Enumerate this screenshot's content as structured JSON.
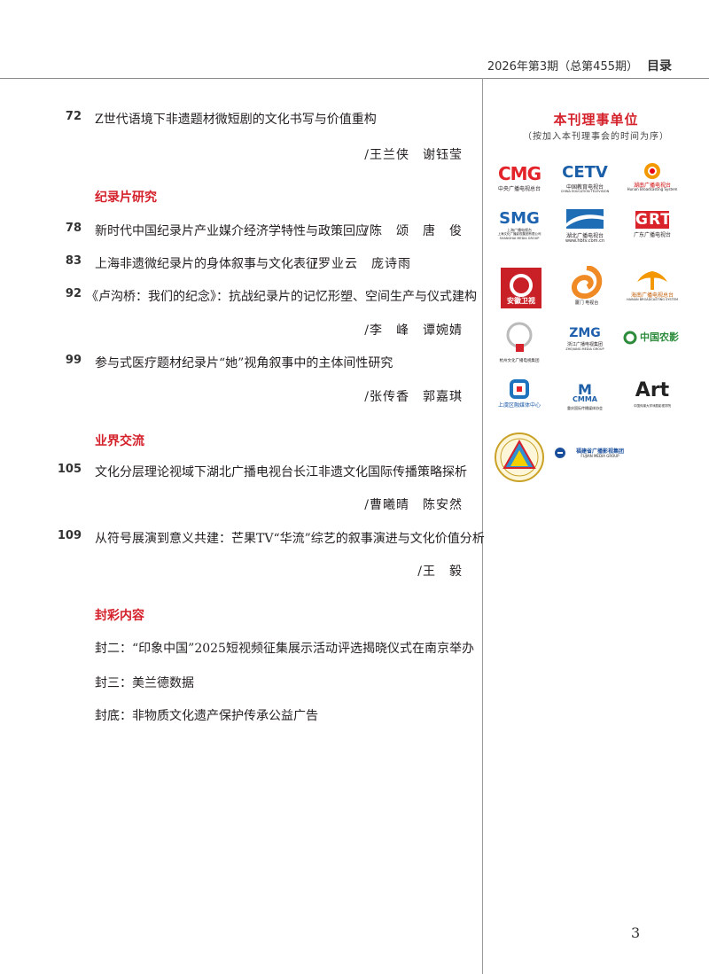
{
  "header": {
    "issue": "2026年第3期（总第455期）",
    "section": "目录"
  },
  "entries_top": {
    "e72": {
      "page": "72",
      "title": "Z世代语境下非遗题材微短剧的文化书写与价值重构",
      "authors": "/王兰侠　谢钰莹"
    }
  },
  "section_documentary": "纪录片研究",
  "documentary": {
    "e78": {
      "page": "78",
      "title": "新时代中国纪录片产业媒介经济学特性与政策回应",
      "authors": "/陈　颂　唐　俊"
    },
    "e83": {
      "page": "83",
      "title": "上海非遗微纪录片的身体叙事与文化表征",
      "authors": "/罗业云　庞诗雨"
    },
    "e92": {
      "page": "92",
      "title": "《卢沟桥：我们的纪念》：抗战纪录片的记忆形塑、空间生产与仪式建构",
      "authors": "/李　峰　谭婉婧"
    },
    "e99": {
      "page": "99",
      "title": "参与式医疗题材纪录片“她”视角叙事中的主体间性研究",
      "authors": "/张传香　郭嘉琪"
    }
  },
  "section_industry": "业界交流",
  "industry": {
    "e105": {
      "page": "105",
      "title": "文化分层理论视域下湖北广播电视台长江非遗文化国际传播策略探析",
      "authors": "/曹曦晴　陈安然"
    },
    "e109": {
      "page": "109",
      "title": "从符号展演到意义共建：芒果TV“华流”综艺的叙事演进与文化价值分析",
      "authors": "/王　毅"
    }
  },
  "section_cover": "封彩内容",
  "cover": {
    "c2": "封二：“印象中国”2025短视频征集展示活动评选揭晓仪式在南京举办",
    "c3": "封三：美兰德数据",
    "c4": "封底：非物质文化遗产保护传承公益广告"
  },
  "council": {
    "title": "本刊理事单位",
    "subtitle": "（按加入本刊理事会的时间为序）",
    "logos": {
      "cmg": {
        "mark": "CMG",
        "caption": "中央广播电视总台"
      },
      "cetv": {
        "mark": "CETV",
        "caption": "中国教育电视台",
        "caption_en": "CHINA EDUCATION TELEVISION"
      },
      "hunan": {
        "caption": "湖南广播电视台",
        "caption_en": "Hunan Broadcasting System"
      },
      "smg": {
        "mark": "SMG",
        "caption": "上海广播电视台",
        "caption_2": "上海文化广播影视集团有限公司",
        "caption_en": "SHANGHAI MEDIA GROUP"
      },
      "hubei": {
        "caption": "湖北广播电视台",
        "caption_2": "www.hbtv.com.cn"
      },
      "grt": {
        "mark": "GRT",
        "caption": "广东广播电视台"
      },
      "anhui": {
        "caption": "安徽卫视"
      },
      "fujian_tv": {
        "caption": "厦门 电视台"
      },
      "hainan": {
        "caption": "海南广播电视总台",
        "caption_en": "HAINAN BROADCASTING SYSTEM"
      },
      "hangzhou": {
        "caption": "杭州文化广播电视集团"
      },
      "zmg": {
        "mark": "ZMG",
        "caption": "浙江广播电视集团",
        "caption_en": "ZHEJIANG MEDIA GROUP"
      },
      "nongye": {
        "mark": "中国农影"
      },
      "shangyu": {
        "caption": "上虞区融媒体中心"
      },
      "cmma": {
        "mark": "CMMA",
        "caption": "重庆国际传播媒体协会"
      },
      "art": {
        "mark": "Art",
        "caption": "中国传媒大学戏剧影视学院"
      },
      "seal": {},
      "fmg": {
        "caption": "福建省广播影视集团",
        "caption_en": "FUJIAN MEDIA GROUP"
      }
    }
  },
  "page_number": "3",
  "colors": {
    "accent": "#d4212b",
    "text": "#231f20",
    "rule": "#8c8c8c"
  }
}
